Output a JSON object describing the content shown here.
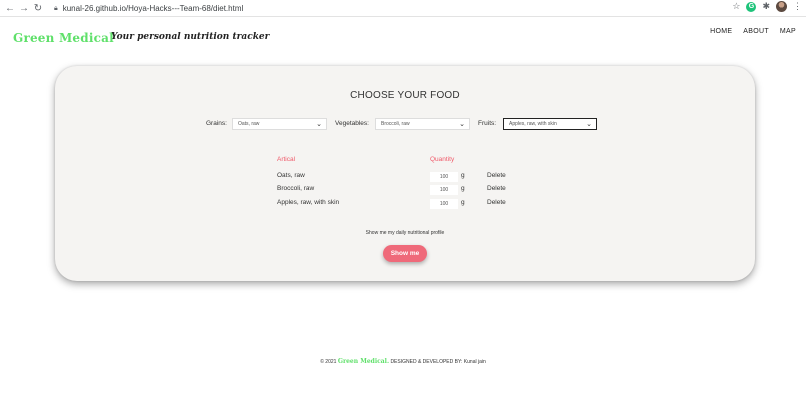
{
  "browser": {
    "url": "kunal-26.github.io/Hoya-Hacks---Team-68/diet.html",
    "icons": [
      "back-icon",
      "forward-icon",
      "reload-icon",
      "lock-icon",
      "star-icon",
      "grammarly-icon",
      "extensions-icon",
      "profile-icon",
      "menu-icon"
    ],
    "extension_letter": "G"
  },
  "header": {
    "brand": "Green Medical",
    "tagline": "Your personal nutrition tracker",
    "nav": [
      "HOME",
      "ABOUT",
      "MAP"
    ]
  },
  "card": {
    "title": "CHOOSE YOUR FOOD",
    "selects": [
      {
        "label": "Grains:",
        "value": "Oats, raw"
      },
      {
        "label": "Vegetables:",
        "value": "Broccoli, raw"
      },
      {
        "label": "Fruits:",
        "value": "Apples, raw, with skin"
      }
    ],
    "columns": {
      "item": "Artical",
      "quantity": "Quantity"
    },
    "rows": [
      {
        "name": "Oats, raw",
        "qty": "100",
        "unit": "g",
        "action": "Delete"
      },
      {
        "name": "Broccoli, raw",
        "qty": "100",
        "unit": "g",
        "action": "Delete"
      },
      {
        "name": "Apples, raw, with skin",
        "qty": "100",
        "unit": "g",
        "action": "Delete"
      }
    ],
    "profile_note": "Show me my daily nutritional profile",
    "show_button": "Show me"
  },
  "footer": {
    "prefix": "© 2021",
    "brand": "Green Medical.",
    "suffix": "DESIGNED & DEVELOPED BY: Kunal jain"
  },
  "colors": {
    "brand_green": "#5fe06a",
    "accent_pink": "#ef6a7a",
    "card_bg": "#f5f4f2"
  }
}
